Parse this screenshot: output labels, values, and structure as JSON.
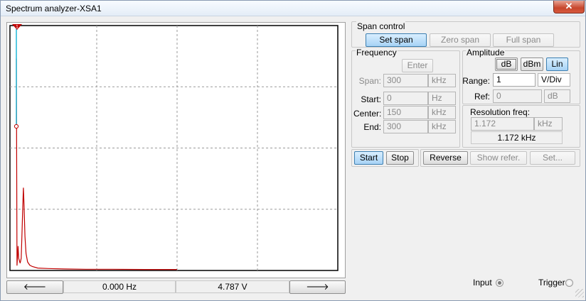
{
  "window": {
    "title": "Spectrum analyzer-XSA1",
    "close_glyph": "✕"
  },
  "cursor": {
    "marker_label": "1"
  },
  "chart_data": {
    "type": "line",
    "x_unit": "kHz",
    "xlim": [
      0,
      300
    ],
    "ylim": [
      0,
      10
    ],
    "grid": true,
    "series": [
      {
        "color": "#c00000",
        "x": [
          0,
          0.6,
          1.1,
          1.6,
          2.2,
          3.5,
          4.5,
          5.2,
          6.0,
          6.6,
          7.2,
          8.0,
          9.0,
          10.5,
          12.5,
          15,
          20,
          30,
          45,
          65,
          90,
          120,
          150
        ],
        "y": [
          8.7,
          0.2,
          0.6,
          1.0,
          0.5,
          0.3,
          0.5,
          1.4,
          2.6,
          3.4,
          2.7,
          1.4,
          0.7,
          0.35,
          0.22,
          0.16,
          0.1,
          0.08,
          0.06,
          0.05,
          0.05,
          0.04,
          0.04
        ]
      }
    ]
  },
  "bottom_bar": {
    "left_arrow_glyph": "🡐",
    "freq_readout": "0.000  Hz",
    "value_readout": "4.787  V",
    "right_arrow_glyph": "🡒"
  },
  "span_control": {
    "title": "Span control",
    "set_span": "Set span",
    "zero_span": "Zero span",
    "full_span": "Full span"
  },
  "frequency": {
    "title": "Frequency",
    "enter": "Enter",
    "span": {
      "label": "Span:",
      "value": "300",
      "unit": "kHz"
    },
    "start": {
      "label": "Start:",
      "value": "0",
      "unit": "Hz"
    },
    "center": {
      "label": "Center:",
      "value": "150",
      "unit": "kHz"
    },
    "end": {
      "label": "End:",
      "value": "300",
      "unit": "kHz"
    }
  },
  "amplitude": {
    "title": "Amplitude",
    "db": "dB",
    "dbm": "dBm",
    "lin": "Lin",
    "range": {
      "label": "Range:",
      "value": "1",
      "unit": "V/Div"
    },
    "ref": {
      "label": "Ref:",
      "value": "0",
      "unit": "dB"
    }
  },
  "resolution": {
    "title": "Resolution freq:",
    "value": "1.172",
    "unit": "kHz",
    "readout": "1.172 kHz"
  },
  "controls": {
    "start": "Start",
    "stop": "Stop",
    "reverse": "Reverse",
    "show_refer": "Show refer.",
    "set": "Set..."
  },
  "io": {
    "input": "Input",
    "trigger": "Trigger"
  },
  "icons": {
    "close": "close-icon",
    "marker": "cursor-marker-icon",
    "left_arrow": "arrow-left-icon",
    "right_arrow": "arrow-right-icon"
  }
}
